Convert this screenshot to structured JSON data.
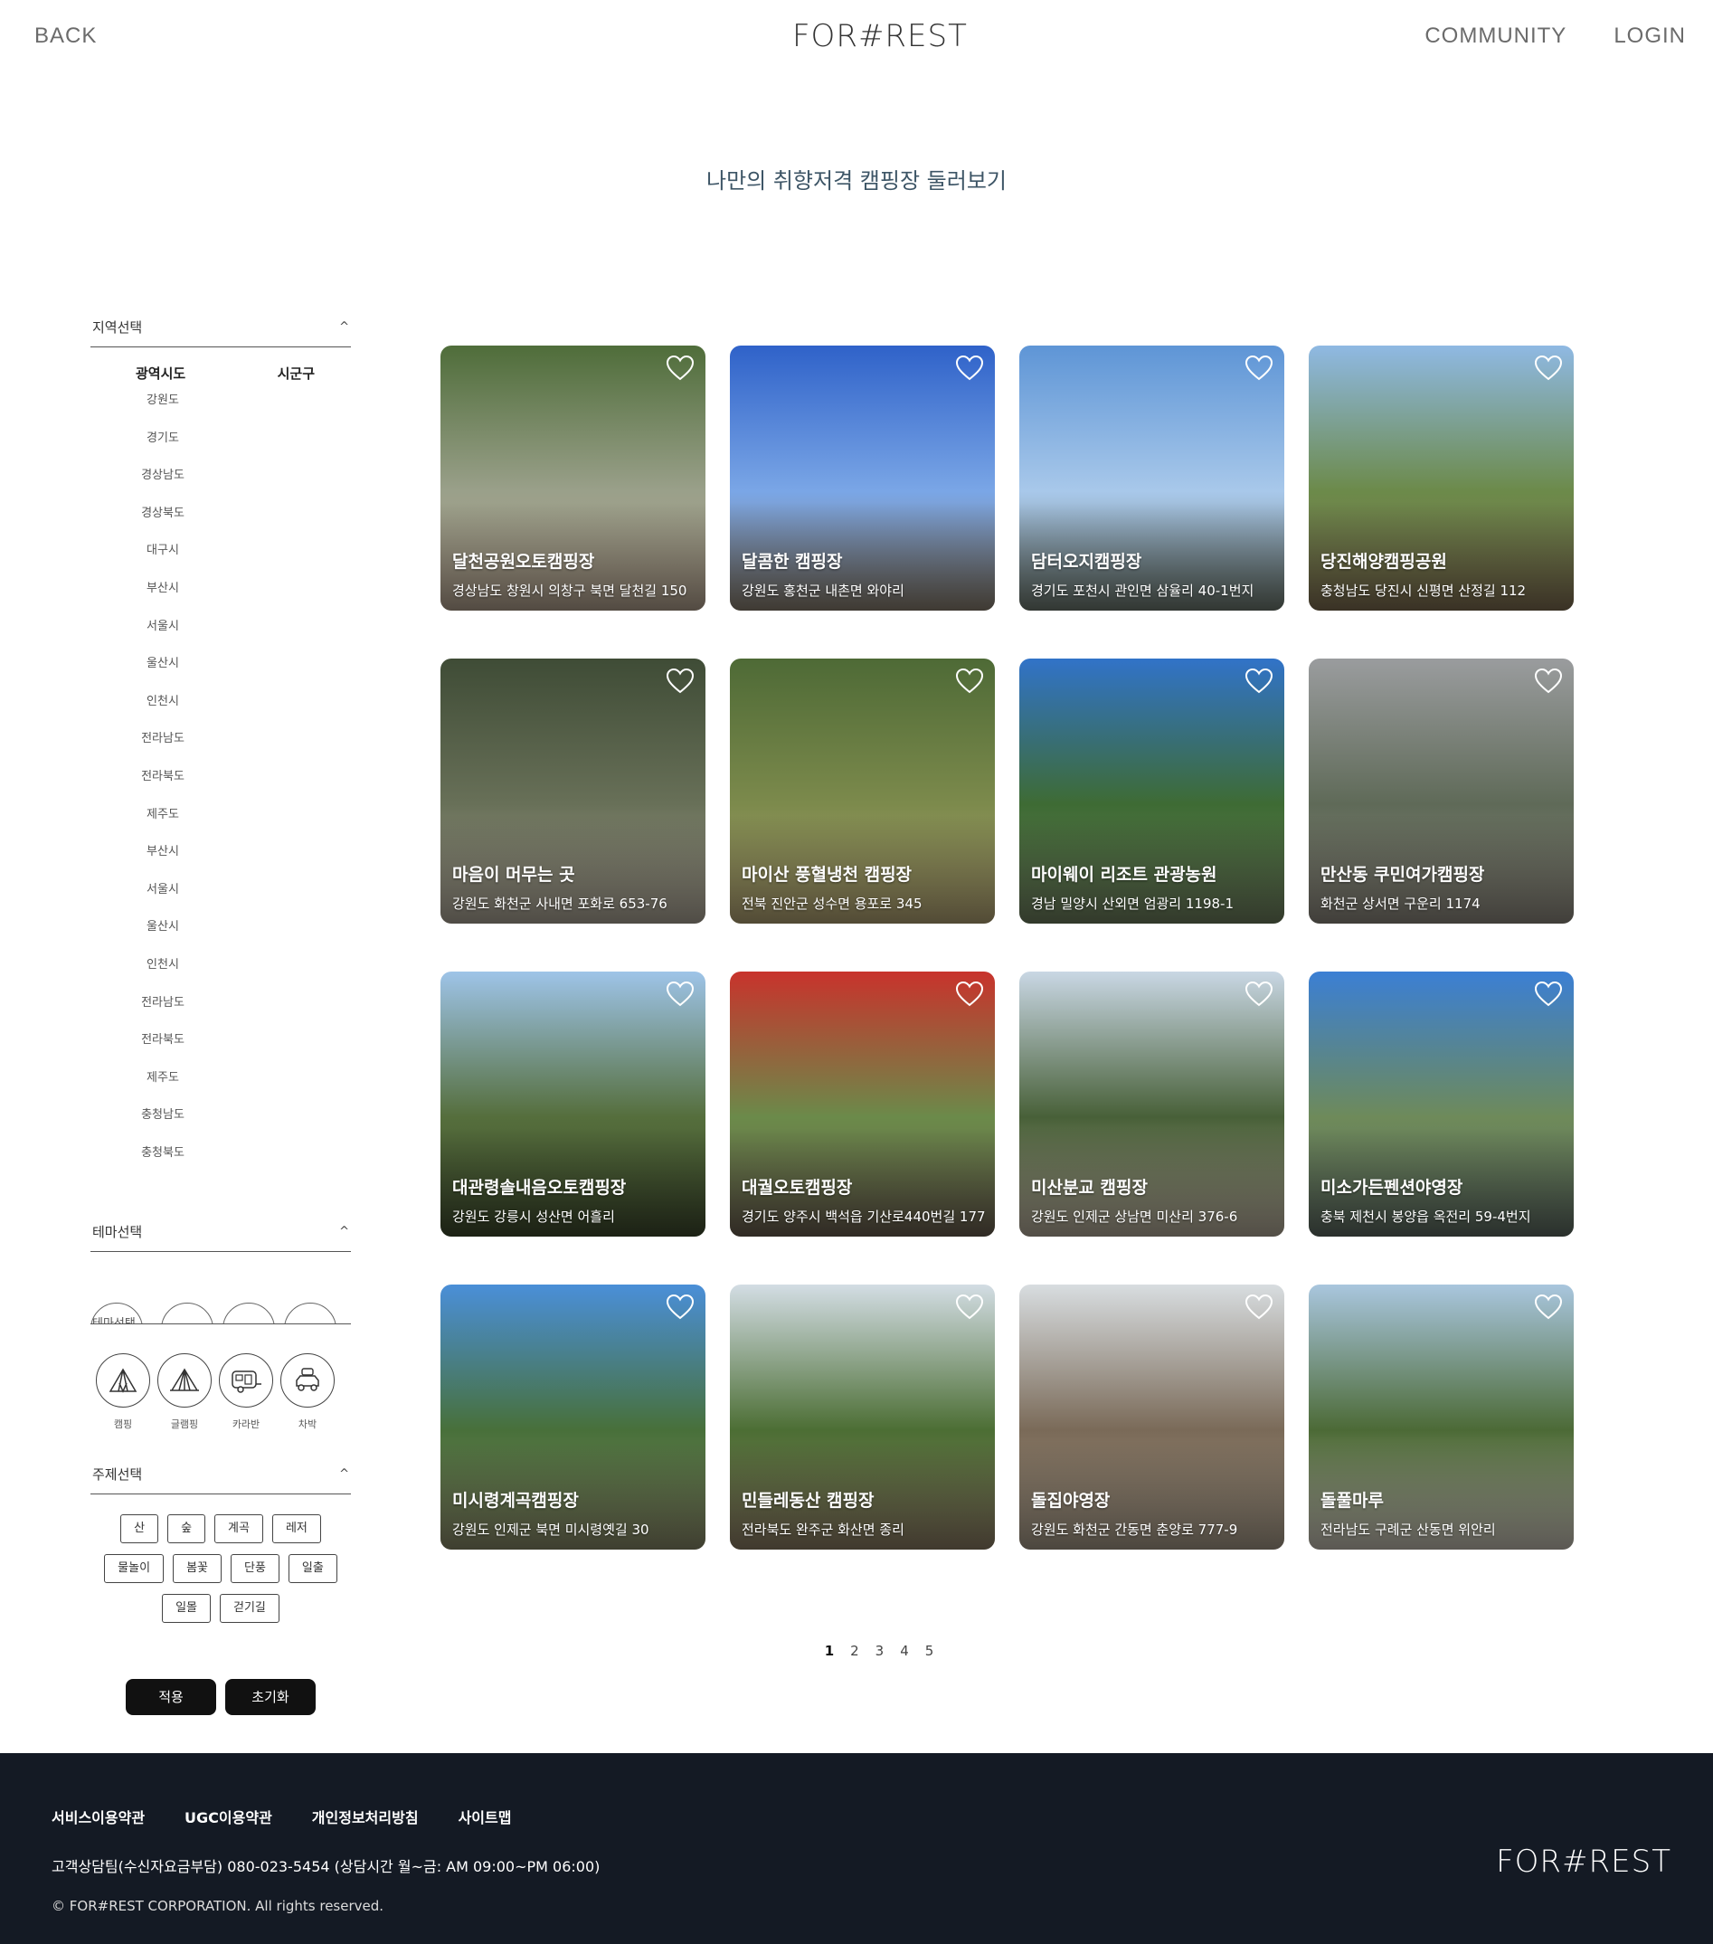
{
  "header": {
    "back": "BACK",
    "logo": "FOR#REST",
    "nav": [
      "COMMUNITY",
      "LOGIN"
    ]
  },
  "page_title": "나만의 취향저격 캠핑장 둘러보기",
  "sidebar": {
    "region": {
      "title": "지역선택",
      "col1": "광역시도",
      "col2": "시군구",
      "items": [
        "강원도",
        "경기도",
        "경상남도",
        "경상북도",
        "대구시",
        "부산시",
        "서울시",
        "울산시",
        "인천시",
        "전라남도",
        "전라북도",
        "제주도",
        "부산시",
        "서울시",
        "울산시",
        "인천시",
        "전라남도",
        "전라북도",
        "제주도",
        "충청남도",
        "충청북도"
      ]
    },
    "theme": {
      "title": "테마선택",
      "tab_partial": "테마선택",
      "items": [
        {
          "label": "캠핑",
          "icon": "tent-icon"
        },
        {
          "label": "글램핑",
          "icon": "glamping-icon"
        },
        {
          "label": "카라반",
          "icon": "caravan-icon"
        },
        {
          "label": "차박",
          "icon": "car-camping-icon"
        }
      ]
    },
    "topic": {
      "title": "주제선택",
      "chips": [
        "산",
        "숲",
        "계곡",
        "레저",
        "물놀이",
        "봄꽃",
        "단풍",
        "일출",
        "일몰",
        "걷기길"
      ]
    },
    "apply": "적용",
    "reset": "초기화"
  },
  "cards": [
    {
      "name": "달천공원오토캠핑장",
      "addr": "경상남도 창원시 의창구 북면 달천길 150",
      "colors": [
        "#4f6d3a",
        "#9aa08a",
        "#b7a592"
      ]
    },
    {
      "name": "달콤한 캠핑장",
      "addr": "강원도 홍천군 내촌면 와야리",
      "colors": [
        "#2f62c9",
        "#7aa6e6",
        "#8b8070"
      ]
    },
    {
      "name": "담터오지캠핑장",
      "addr": "경기도 포천시 관인면 삼율리 40-1번지",
      "colors": [
        "#5e95d6",
        "#a8c8ea",
        "#6f7a70"
      ]
    },
    {
      "name": "당진해양캠핑공원",
      "addr": "충청남도 당진시 신평면 산정길 112",
      "colors": [
        "#8fb9e3",
        "#6c8a4a",
        "#7f6e52"
      ]
    },
    {
      "name": "마음이 머무는 곳",
      "addr": "강원도 화천군 사내면 포화로 653-76",
      "colors": [
        "#3f4c36",
        "#687058",
        "#b0a89a"
      ]
    },
    {
      "name": "마이산 풍혈냉천 캠핑장",
      "addr": "전북 진안군 성수면 용포로 345",
      "colors": [
        "#4e6a36",
        "#7c8a4c",
        "#b5a576"
      ]
    },
    {
      "name": "마이웨이 리조트 관광농원",
      "addr": "경남 밀양시 산외면 엄광리 1198-1",
      "colors": [
        "#3173c8",
        "#3e6b34",
        "#6f7f5f"
      ]
    },
    {
      "name": "만산동 쿠민여가캠핑장",
      "addr": "화천군 상서면 구운리 1174",
      "colors": [
        "#9a9c9e",
        "#5f6a58",
        "#8f8a80"
      ]
    },
    {
      "name": "대관령솔내음오토캠핑장",
      "addr": "강원도 강릉시 성산면 어흘리",
      "colors": [
        "#9ec4e8",
        "#556e3c",
        "#3e4a2e"
      ]
    },
    {
      "name": "대궐오토캠핑장",
      "addr": "경기도 양주시 백석읍 기산로440번길 177",
      "colors": [
        "#c8332c",
        "#6b8a4a",
        "#6a5e50"
      ]
    },
    {
      "name": "미산분교 캠핑장",
      "addr": "강원도 인제군 상남면 미산리 376-6",
      "colors": [
        "#c9d7e4",
        "#486038",
        "#b7ad9c"
      ]
    },
    {
      "name": "미소가든펜션야영장",
      "addr": "충북 제천시 봉양읍 옥전리 59-4번지",
      "colors": [
        "#3b7fd4",
        "#6e8a5a",
        "#5d6a62"
      ]
    },
    {
      "name": "미시령계곡캠핑장",
      "addr": "강원도 인제군 북면 미시령옛길 30",
      "colors": [
        "#4a8fd8",
        "#48703a",
        "#8a8a6a"
      ]
    },
    {
      "name": "민들레동산 캠핑장",
      "addr": "전라북도 완주군 화산면 종리",
      "colors": [
        "#d3dde4",
        "#4c6e34",
        "#8e7e66"
      ]
    },
    {
      "name": "돌집야영장",
      "addr": "강원도 화천군 간동면 춘양로 777-9",
      "colors": [
        "#d8dde0",
        "#7a6a58",
        "#a89c8a"
      ]
    },
    {
      "name": "돌풀마루",
      "addr": "전라남도 구례군 산동면 위안리",
      "colors": [
        "#a9c6de",
        "#4c6a36",
        "#c9c3b8"
      ]
    }
  ],
  "pagination": {
    "pages": [
      "1",
      "2",
      "3",
      "4",
      "5"
    ],
    "current": "1"
  },
  "footer": {
    "links": [
      "서비스이용약관",
      "UGC이용약관",
      "개인정보처리방침",
      "사이트맵"
    ],
    "phone": "고객상담팀(수신자요금부담) 080-023-5454 (상담시간 월~금: AM 09:00~PM 06:00)",
    "copyright": "© FOR#REST CORPORATION. All rights reserved.",
    "logo": "FOR#REST"
  }
}
